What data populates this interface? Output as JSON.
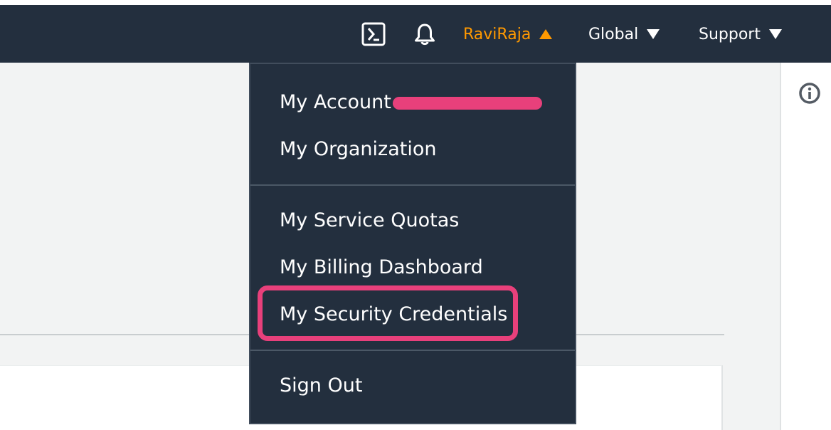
{
  "navbar": {
    "cloudshell_icon": "terminal-icon",
    "notifications_icon": "bell-icon",
    "user_label": "RaviRaja",
    "region_label": "Global",
    "support_label": "Support",
    "colors": {
      "background": "#232f3e",
      "user_accent": "#ff9900"
    }
  },
  "dropdown": {
    "account_label": "My Account",
    "organization_label": "My Organization",
    "service_quotas_label": "My Service Quotas",
    "billing_label": "My Billing Dashboard",
    "security_credentials_label": "My Security Credentials",
    "sign_out_label": "Sign Out"
  },
  "side_panel": {
    "info_icon": "info-icon"
  },
  "annotations": {
    "highlight_color": "#e8407b"
  }
}
